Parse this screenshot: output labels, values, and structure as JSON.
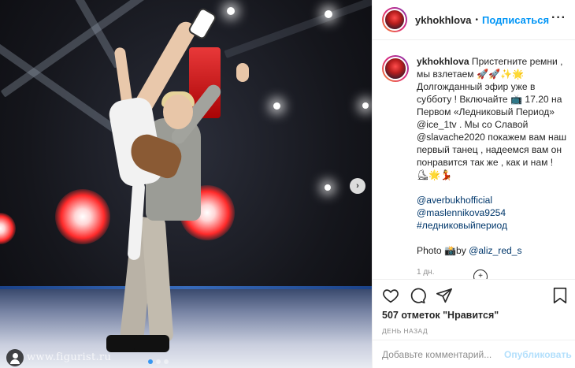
{
  "post": {
    "username": "ykhokhlova",
    "follow_label": "Подписаться",
    "separator": "•",
    "more_label": "···"
  },
  "photo": {
    "watermark": "www.figurist.ru",
    "carousel_dots": 3,
    "active_dot": 1
  },
  "caption": {
    "username": "ykhokhlova",
    "lines": [
      "Пристегните ремни , мы взлетаем 🚀🚀✨🌟",
      "Долгожданный эфир уже в субботу ! Включайте 📺 17.20 на Первом «Ледниковый Период» @ice_1tv . Мы со Славой @slavache2020 покажем вам наш первый танец , надеемся вам он понравится так же , как и нам !",
      "⛸🌟💃"
    ],
    "mentions": [
      "@averbukhofficial",
      "@maslennikova9254",
      "#ледниковыйпериод"
    ],
    "photo_prefix": "Photo 📸by ",
    "photo_credit": "@aliz_red_s",
    "time": "1 дн."
  },
  "actions": {
    "likes": "507 отметок \"Нравится\"",
    "date": "ДЕНЬ НАЗАД",
    "icons": [
      "heart-icon",
      "comment-icon",
      "share-icon",
      "bookmark-icon"
    ]
  },
  "comment": {
    "placeholder": "Добавьте комментарий...",
    "publish_label": "Опубликовать"
  },
  "colors": {
    "accent": "#0095f6",
    "publish_disabled": "#b2dffc",
    "mention": "#00376b",
    "muted": "#8e8e8e"
  }
}
